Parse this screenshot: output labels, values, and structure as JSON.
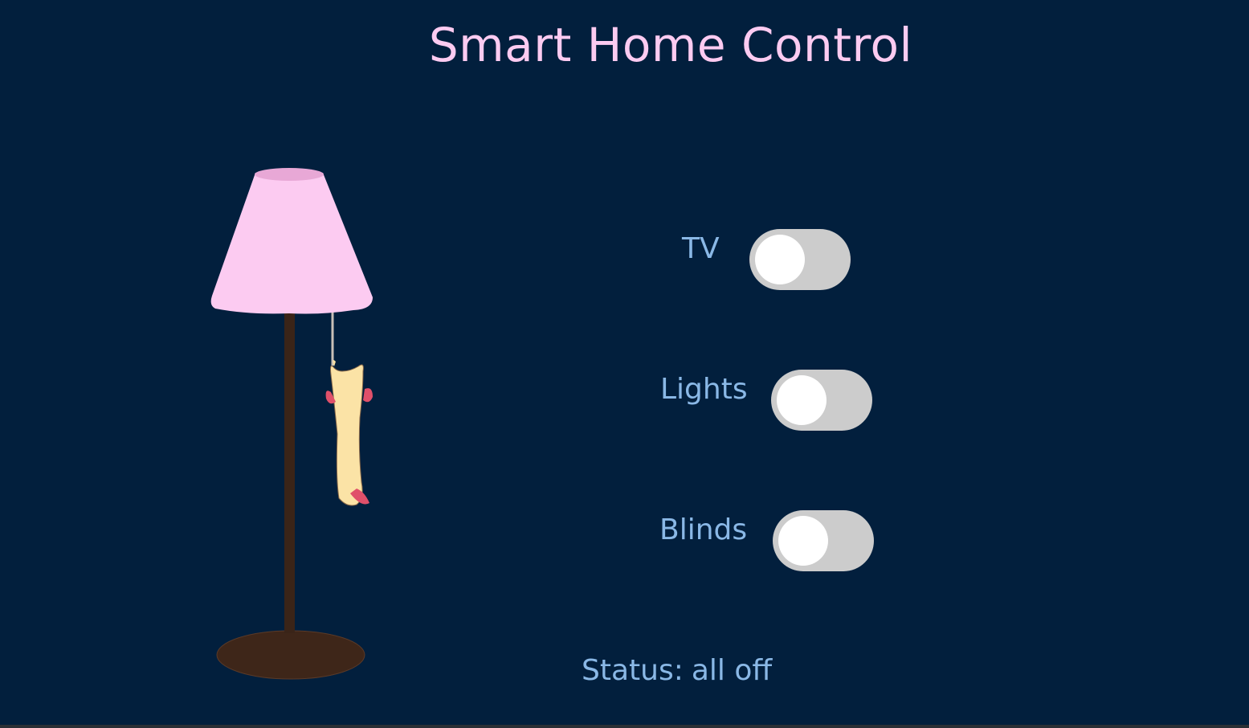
{
  "header": {
    "title": "Smart Home Control"
  },
  "devices": [
    {
      "label": "TV",
      "state": "off"
    },
    {
      "label": "Lights",
      "state": "off"
    },
    {
      "label": "Blinds",
      "state": "off"
    }
  ],
  "status": {
    "label": "Status:",
    "value": "all off"
  },
  "colors": {
    "background": "#021f3d",
    "title": "#fccbf1",
    "label": "#8ab8e6",
    "toggle_track_off": "#cccccc",
    "toggle_knob": "#ffffff",
    "lamp_shade": "#fccbf1",
    "lamp_pole": "#3a2418"
  },
  "illustration": {
    "icon": "floor-lamp-with-pull-cord-cat"
  }
}
